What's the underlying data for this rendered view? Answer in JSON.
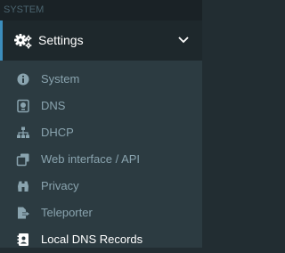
{
  "sidebar": {
    "section_header": "SYSTEM",
    "settings": {
      "label": "Settings",
      "icon": "cogs-icon",
      "expanded": true
    },
    "items": [
      {
        "label": "System",
        "icon": "info-circle-icon"
      },
      {
        "label": "DNS",
        "icon": "dns-server-icon"
      },
      {
        "label": "DHCP",
        "icon": "sitemap-icon"
      },
      {
        "label": "Web interface / API",
        "icon": "window-copy-icon"
      },
      {
        "label": "Privacy",
        "icon": "binoculars-icon"
      },
      {
        "label": "Teleporter",
        "icon": "file-export-icon"
      },
      {
        "label": "Local DNS Records",
        "icon": "address-card-icon",
        "active": true
      }
    ]
  },
  "colors": {
    "sidebar_bg": "#222d32",
    "submenu_bg": "#2c3b41",
    "accent": "#3c8dbc",
    "text_muted": "#8aa4af",
    "text_active": "#ffffff"
  }
}
